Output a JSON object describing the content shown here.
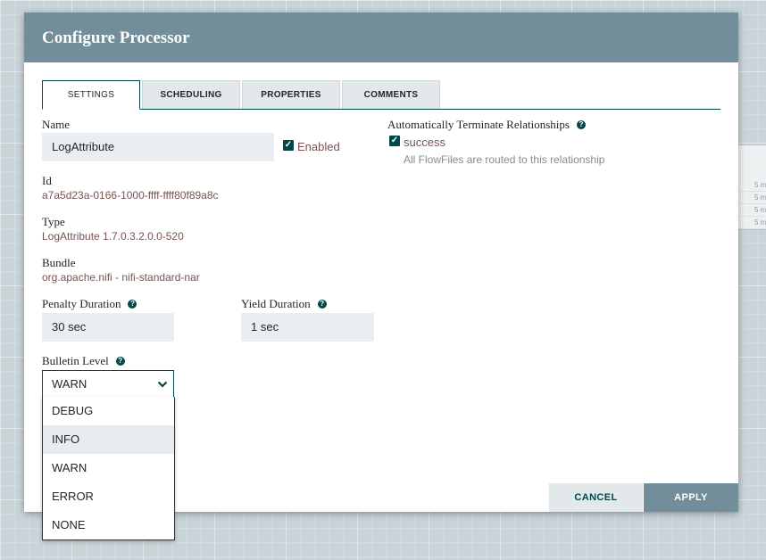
{
  "background_panel": {
    "rows": [
      "5 m",
      "5 m",
      "5 m",
      "5 m"
    ]
  },
  "dialog": {
    "title": "Configure Processor",
    "tabs": [
      {
        "label": "SETTINGS",
        "active": true
      },
      {
        "label": "SCHEDULING",
        "active": false
      },
      {
        "label": "PROPERTIES",
        "active": false
      },
      {
        "label": "COMMENTS",
        "active": false
      }
    ],
    "settings": {
      "name_label": "Name",
      "name_value": "LogAttribute",
      "enabled_label": "Enabled",
      "enabled_checked": true,
      "id_label": "Id",
      "id_value": "a7a5d23a-0166-1000-ffff-ffff80f89a8c",
      "type_label": "Type",
      "type_value": "LogAttribute 1.7.0.3.2.0.0-520",
      "bundle_label": "Bundle",
      "bundle_value": "org.apache.nifi - nifi-standard-nar",
      "penalty_label": "Penalty Duration",
      "penalty_value": "30 sec",
      "yield_label": "Yield Duration",
      "yield_value": "1 sec",
      "bulletin_label": "Bulletin Level",
      "bulletin_selected": "WARN",
      "bulletin_options": [
        "DEBUG",
        "INFO",
        "WARN",
        "ERROR",
        "NONE"
      ],
      "bulletin_hovered": "INFO",
      "auto_terminate_label": "Automatically Terminate Relationships",
      "relationship_name": "success",
      "relationship_checked": true,
      "relationship_desc": "All FlowFiles are routed to this relationship"
    },
    "buttons": {
      "cancel": "CANCEL",
      "apply": "APPLY"
    }
  },
  "colors": {
    "header": "#728e9b",
    "accent": "#004849",
    "value_text": "#775351"
  }
}
